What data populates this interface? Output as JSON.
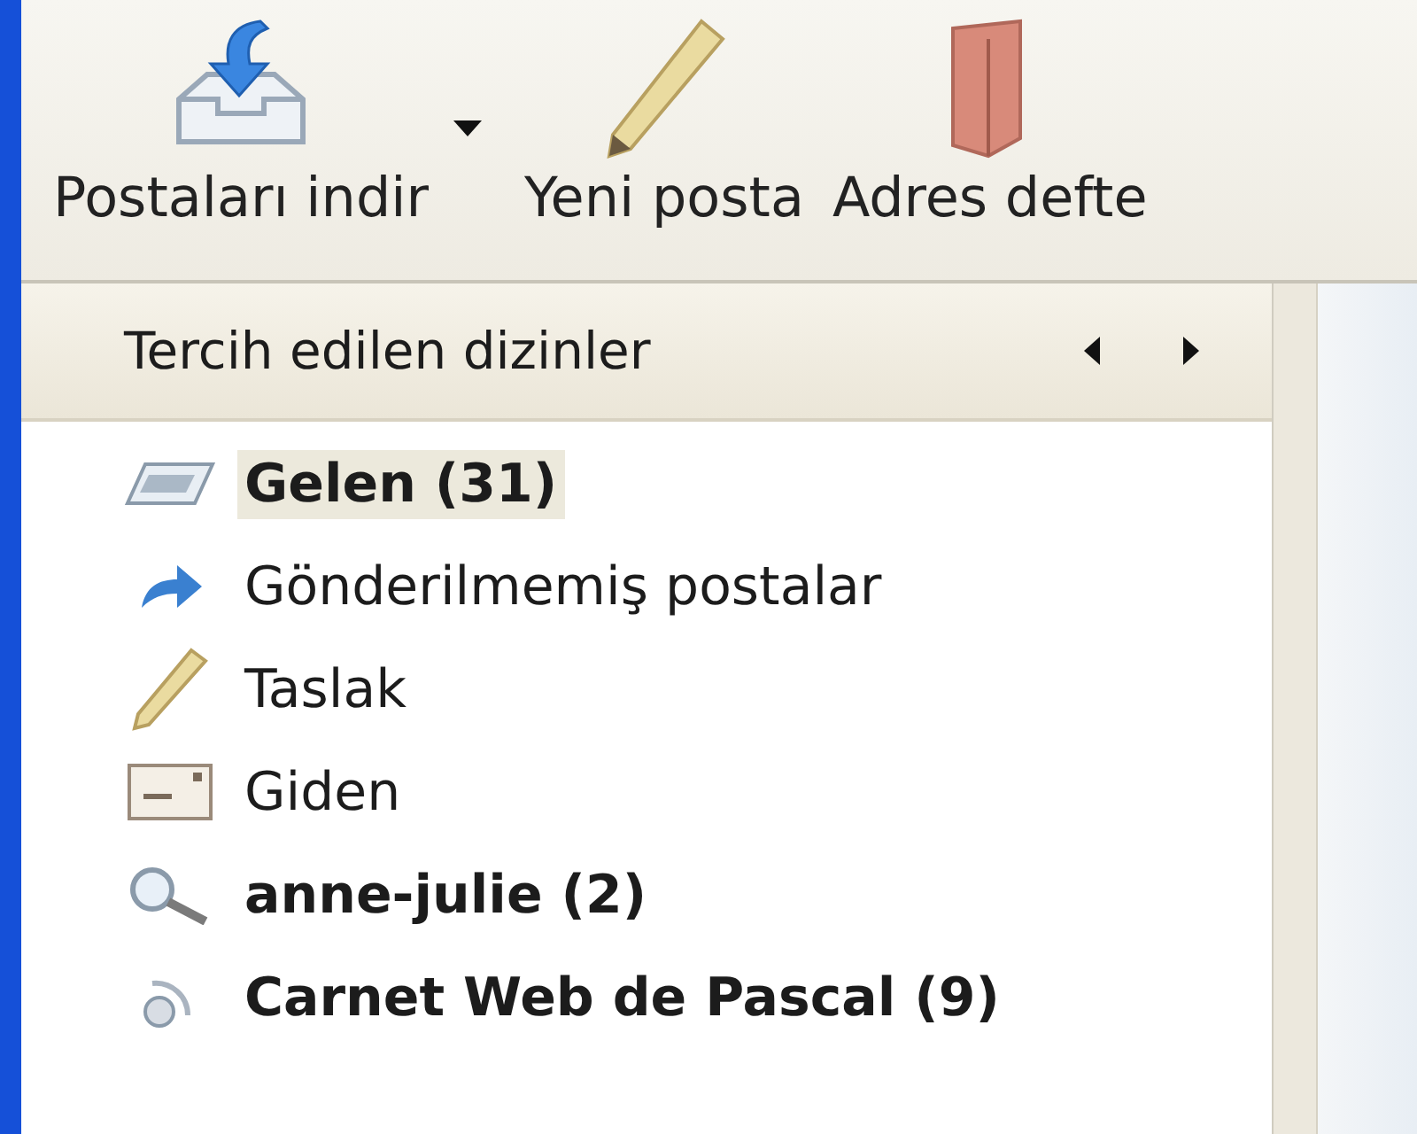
{
  "toolbar": {
    "buttons": [
      {
        "label": "Postaları indir",
        "kind": "download",
        "has_menu": true
      },
      {
        "label": "Yeni posta",
        "kind": "compose",
        "has_menu": false
      },
      {
        "label": "Adres defte",
        "kind": "addressbook",
        "has_menu": false
      }
    ]
  },
  "folder_pane": {
    "header": {
      "title": "Tercih edilen dizinler"
    },
    "folders": [
      {
        "label": "Gelen (31)",
        "kind": "inbox",
        "bold": true,
        "selected": true
      },
      {
        "label": "Gönderilmemiş postalar",
        "kind": "unsent",
        "bold": false,
        "selected": false
      },
      {
        "label": "Taslak",
        "kind": "drafts",
        "bold": false,
        "selected": false
      },
      {
        "label": "Giden",
        "kind": "outbox",
        "bold": false,
        "selected": false
      },
      {
        "label": "anne-julie (2)",
        "kind": "search",
        "bold": true,
        "selected": false
      },
      {
        "label": "Carnet Web de Pascal (9)",
        "kind": "feed",
        "bold": true,
        "selected": false
      }
    ]
  }
}
